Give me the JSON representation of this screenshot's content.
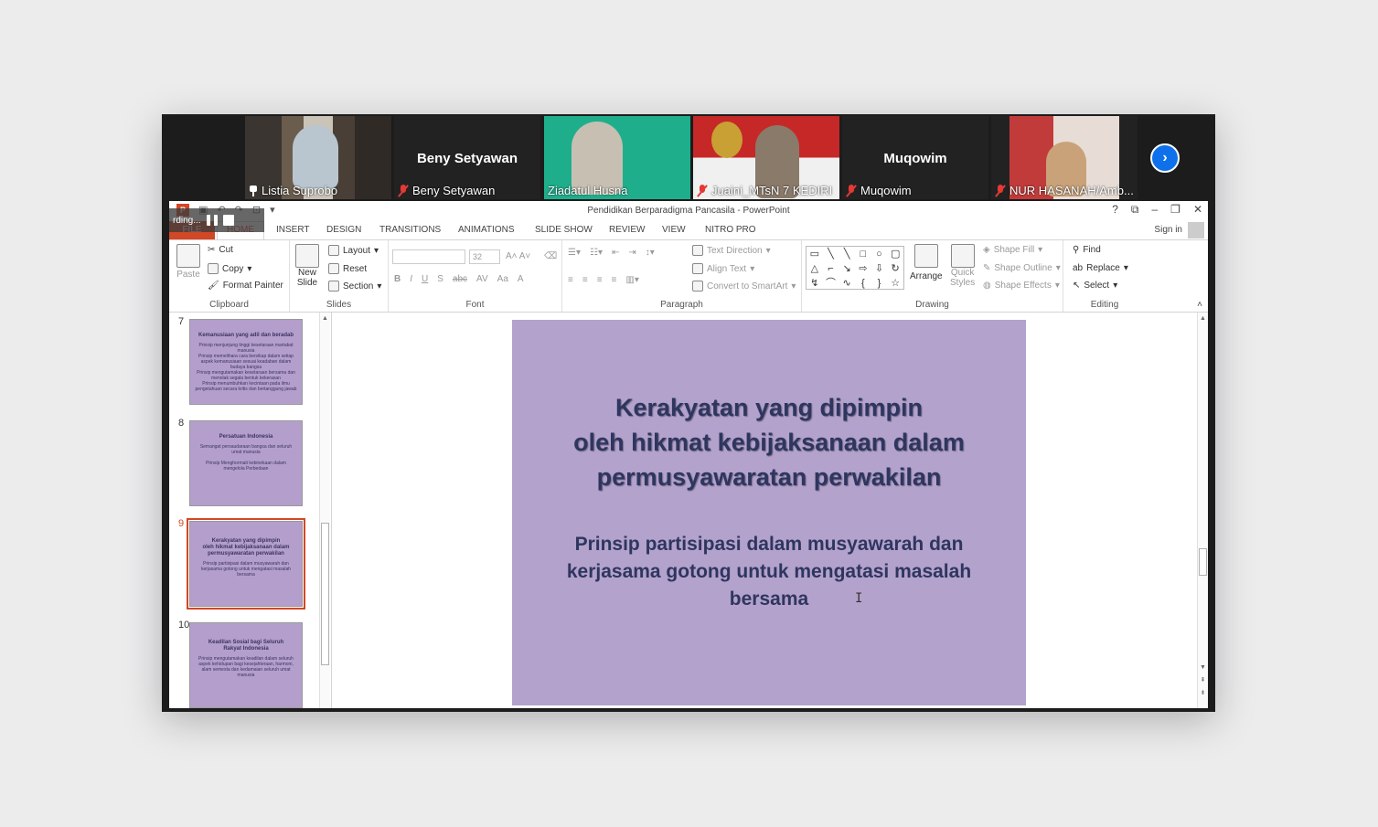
{
  "gallery": {
    "participants": [
      {
        "display_name": "",
        "label": "Listia Suprobo",
        "state": "pinned"
      },
      {
        "display_name": "Beny Setyawan",
        "label": "Beny Setyawan",
        "state": "muted"
      },
      {
        "display_name": "",
        "label": "Ziadatul Husna",
        "state": "none"
      },
      {
        "display_name": "",
        "label": "Juaini_MTsN 7 KEDIRI",
        "state": "muted"
      },
      {
        "display_name": "Muqowim",
        "label": "Muqowim",
        "state": "muted"
      },
      {
        "display_name": "",
        "label": "NUR HASANAH/Amb...",
        "state": "muted"
      }
    ],
    "next_icon": "chevron-right-icon"
  },
  "recording": {
    "label": "rding..."
  },
  "window": {
    "title": "Pendidikan Berparadigma Pancasila - PowerPoint",
    "sign_in": "Sign in",
    "controls": [
      "?",
      "⧉",
      "–",
      "❐",
      "✕"
    ]
  },
  "tabs": {
    "file": "FILE",
    "items": [
      "HOME",
      "INSERT",
      "DESIGN",
      "TRANSITIONS",
      "ANIMATIONS",
      "SLIDE SHOW",
      "REVIEW",
      "VIEW",
      "NITRO PRO"
    ]
  },
  "ribbon": {
    "clipboard": {
      "paste": "Paste",
      "cut": "Cut",
      "copy": "Copy",
      "format_painter": "Format Painter",
      "name": "Clipboard"
    },
    "slides": {
      "new_slide_1": "New",
      "new_slide_2": "Slide",
      "layout": "Layout",
      "reset": "Reset",
      "section": "Section",
      "name": "Slides"
    },
    "font": {
      "size": "32",
      "bold": "B",
      "italic": "I",
      "underline": "U",
      "shadow": "S",
      "strike": "abc",
      "spacing": "AV",
      "case": "Aa",
      "color": "A",
      "name": "Font"
    },
    "paragraph": {
      "text_direction": "Text Direction",
      "align_text": "Align Text",
      "convert": "Convert to SmartArt",
      "name": "Paragraph"
    },
    "drawing": {
      "arrange": "Arrange",
      "quick_1": "Quick",
      "quick_2": "Styles",
      "fill": "Shape Fill",
      "outline": "Shape Outline",
      "effects": "Shape Effects",
      "name": "Drawing",
      "shapes": [
        "▭",
        "╲",
        "╲",
        "□",
        "○",
        "▢",
        "△",
        "⌐",
        "↘",
        "⇨",
        "⇩",
        "↻",
        "↯",
        "⌒",
        "∿",
        "{",
        "}",
        "☆"
      ]
    },
    "editing": {
      "find": "Find",
      "replace": "Replace",
      "select": "Select",
      "name": "Editing"
    }
  },
  "thumbnails": [
    {
      "num": "7",
      "title": "Kemanusiaan yang adil dan beradab",
      "body": "Prinsip menjunjung tinggi kesetaraan martabat manusia\nPrinsip memelihara cara bersikap dalam setiap aspek kemanusiaan sesuai keadaban dalam budaya bangsa\nPrinsip mengutamakan kesetaraan bersama dan menolak segala bentuk kekerasan\nPrinsip menumbuhkan kecintaan pada ilmu pengetahuan secara kritis dan bertanggung jawab",
      "selected": false
    },
    {
      "num": "8",
      "title": "Persatuan Indonesia",
      "body": "Semangat persaudaraan bangsa dan seluruh umat manusia\n\nPrinsip Menghormati kebinekaan dalam mengelola Perbedaan",
      "selected": false
    },
    {
      "num": "9",
      "title": "Kerakyatan yang dipimpin\noleh hikmat kebijaksanaan dalam\npermusyawaratan perwakilan",
      "body": "Prinsip partisipasi dalam musyawarah dan\nkerjasama gotong untuk mengatasi masalah\nbersama",
      "selected": true
    },
    {
      "num": "10",
      "title": "Keadilan Sosial bagi Seluruh\nRakyat Indonesia",
      "body": "Prinsip mengutamakan keadilan dalam seluruh aspek kehidupan bagi kesejahteraan, harmoni, alam semesta dan kedamaian seluruh umat manusia",
      "selected": false
    }
  ],
  "slide": {
    "title": "Kerakyatan yang dipimpin\noleh hikmat kebijaksanaan dalam\npermusyawaratan perwakilan",
    "body": "Prinsip partisipasi dalam musyawarah dan\nkerjasama gotong untuk mengatasi masalah\nbersama",
    "background": "#b3a2cb",
    "text_color": "#2e3660"
  },
  "colors": {
    "accent": "#d24726",
    "zoom_blue": "#0e71eb",
    "active_speaker": "#8ac83c"
  }
}
